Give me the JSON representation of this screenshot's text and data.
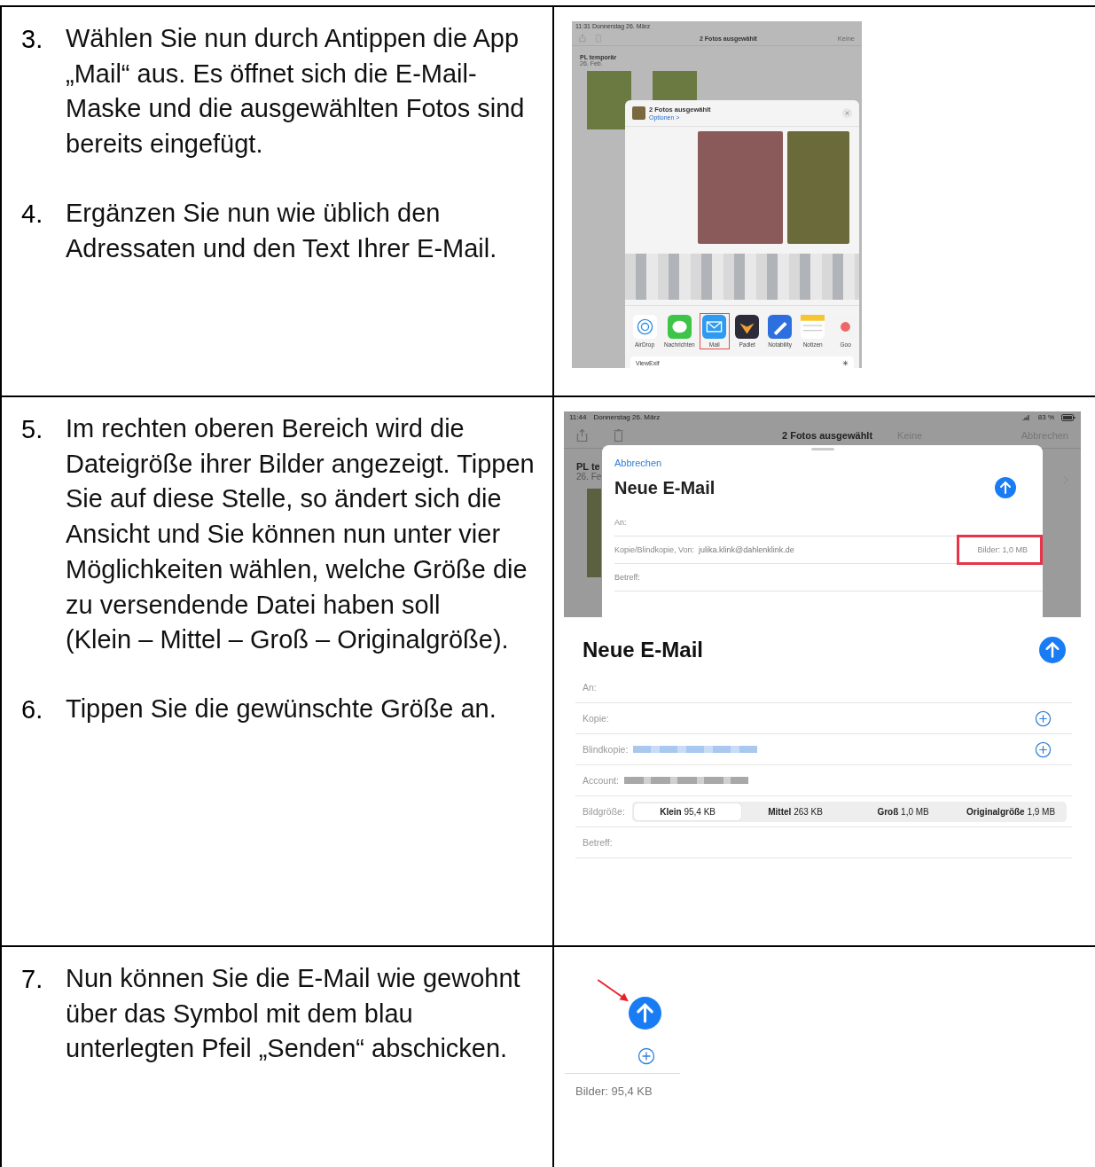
{
  "rows": [
    {
      "steps": [
        {
          "number": "3.",
          "text": "Wählen Sie nun durch Antippen die App „Mail“ aus. Es öffnet sich die E-Mail-Maske und die ausgewählten Fotos sind bereits eingefügt."
        },
        {
          "number": "4.",
          "text": "Ergänzen Sie nun wie üblich den Adressaten und den Text Ihrer E-Mail."
        }
      ],
      "screenshots": [
        {
          "kind": "share_sheet",
          "status_time": "11:31 Donnerstag 26. März",
          "title": "2 Fotos ausgewählt",
          "right_action": "Keine",
          "album": "PL temporär",
          "album_date": "26. Feb.",
          "sheet_title": "2 Fotos ausgewählt",
          "sheet_options": "Optionen >",
          "apps": [
            {
              "label": "AirDrop",
              "selected": false
            },
            {
              "label": "Nachrichten",
              "selected": false
            },
            {
              "label": "Mail",
              "selected": true
            },
            {
              "label": "Padlet",
              "selected": false
            },
            {
              "label": "Notability",
              "selected": false
            },
            {
              "label": "Notizen",
              "selected": false
            },
            {
              "label": "Goo",
              "selected": false
            }
          ],
          "action": "ViewExif"
        }
      ]
    },
    {
      "steps": [
        {
          "number": "5.",
          "text": "Im rechten oberen Bereich wird die Dateigröße ihrer Bilder angezeigt. Tippen Sie auf diese Stelle, so ändert sich die Ansicht und Sie können nun unter vier Möglichkeiten wählen, welche Größe die zu versendende Datei haben soll\n(Klein – Mittel – Groß – Originalgröße)."
        },
        {
          "number": "6.",
          "text": "Tippen Sie die gewünschte Größe an."
        }
      ],
      "screenshots": [
        {
          "kind": "compose_sheet",
          "status_time": "11:44",
          "status_date": "Donnerstag 26. März",
          "battery": "83 %",
          "title": "2 Fotos ausgewählt",
          "right_actions": [
            "Keine",
            "Abbrechen"
          ],
          "album": "PL te",
          "album_date": "26. Fe",
          "cancel": "Abbrechen",
          "heading": "Neue E-Mail",
          "fields": [
            {
              "label": "An:"
            },
            {
              "label": "Kopie/Blindkopie, Von:",
              "value": "julika.klink@dahlenklink.de",
              "extra": "Bilder: 1,0 MB",
              "highlighted": true
            },
            {
              "label": "Betreff:"
            }
          ]
        },
        {
          "kind": "compose_sizes",
          "heading": "Neue E-Mail",
          "fields": [
            {
              "kind": "plain",
              "label": "An:"
            },
            {
              "kind": "add",
              "label": "Kopie:"
            },
            {
              "kind": "blurred_blue",
              "label": "Blindkopie:"
            },
            {
              "kind": "blurred_gray",
              "label": "Account:"
            },
            {
              "kind": "sizes",
              "label": "Bildgröße:",
              "options": [
                {
                  "name": "Klein",
                  "size": "95,4 KB",
                  "selected": true
                },
                {
                  "name": "Mittel",
                  "size": "263 KB",
                  "selected": false
                },
                {
                  "name": "Groß",
                  "size": "1,0 MB",
                  "selected": false
                },
                {
                  "name": "Originalgröße",
                  "size": "1,9 MB",
                  "selected": false
                }
              ]
            },
            {
              "kind": "plain",
              "label": "Betreff:"
            }
          ]
        }
      ]
    },
    {
      "steps": [
        {
          "number": "7.",
          "text": "Nun können Sie die E-Mail wie gewohnt über das Symbol mit dem blau unterlegten Pfeil „Senden“ abschicken."
        }
      ],
      "screenshots": [
        {
          "kind": "send_detail",
          "images": "Bilder: 95,4 KB"
        }
      ]
    }
  ]
}
